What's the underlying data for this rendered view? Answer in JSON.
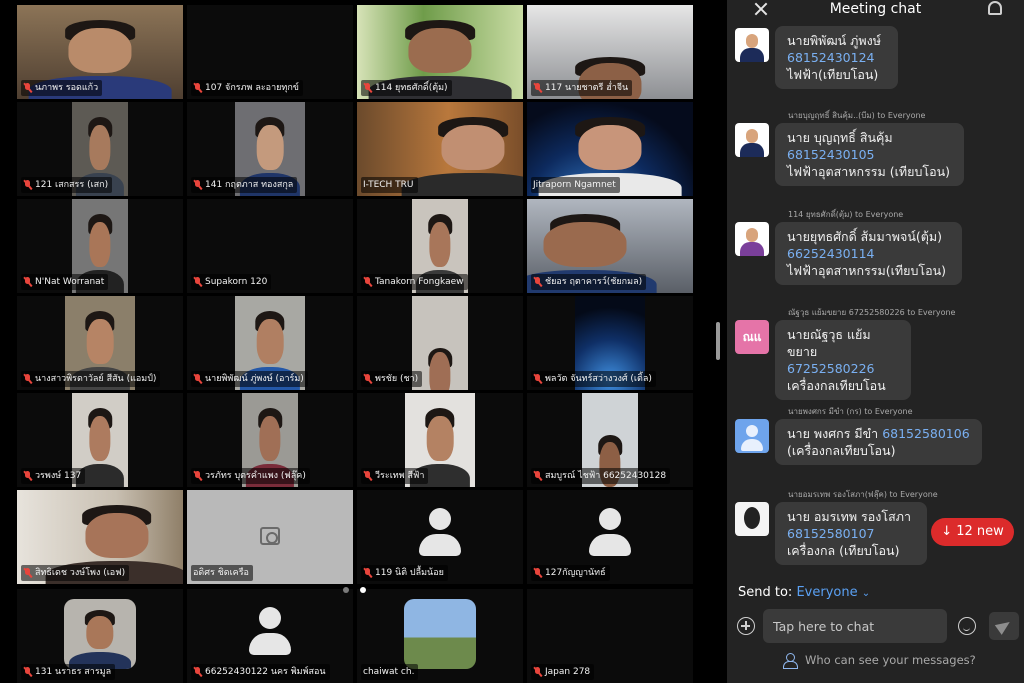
{
  "chat": {
    "title": "Meeting chat",
    "new_messages": "↓ 12 new",
    "send_to_label": "Send to:",
    "send_to_value": "Everyone",
    "input_placeholder": "Tap here to chat",
    "who_can_see": "Who can see your messages?",
    "messages": [
      {
        "header": "",
        "lines": [
          "นายพิพัฒน์ ภู่พงษ์",
          "68152430124",
          "ไฟฟ้า(เทียบโอน)"
        ]
      },
      {
        "header": "นายบุญฤทธิ์ สินคุ้ม..(บีม) to Everyone",
        "lines": [
          "นาย บุญฤทธิ์ สินคุ้ม",
          "68152430105",
          "ไฟฟ้าอุตสาหกรรม (เทียบโอน)"
        ]
      },
      {
        "header": "114 ยุทธศักดิ์(ตุ้ม) to Everyone",
        "lines": [
          "นายยุทธศักดิ์ ส้มมาพจน์(ตุ้ม)",
          "66252430114",
          "ไฟฟ้าอุตสาหกรรม(เทียบโอน)"
        ]
      },
      {
        "header": "ณัฐวุธ แย้มขยาย 67252580226 to Everyone",
        "lines": [
          "นายณัฐวุธ แย้มขยาย",
          "67252580226",
          "เครื่องกลเทียบโอน"
        ],
        "initials": "ณแ"
      },
      {
        "header": "นายพงศกร มีขำ (กร) to Everyone",
        "lines": [
          "นาย พงศกร มีขำ ",
          "68152580106",
          "(เครื่องกลเทียบโอน)"
        ]
      },
      {
        "header": "นายอมรเทพ รองโสภา(ฟลุ๊ค) to Everyone",
        "lines": [
          "นาย อมรเทพ รองโสภา",
          "68152580107",
          "เครื่องกล (เทียบโอน)"
        ]
      }
    ]
  },
  "participants": [
    {
      "name": "นภาพร รอดแก้ว"
    },
    {
      "name": "107 จักรภพ ละอายทุกข์"
    },
    {
      "name": "114 ยุทธศักดิ์(ตุ้ม)"
    },
    {
      "name": "117 นายชาตรี ฮ่ำจีน"
    },
    {
      "name": "121 เสกสรร (เสก)"
    },
    {
      "name": "141 กฤตภาส ทองสกุล"
    },
    {
      "name": "I-TECH TRU"
    },
    {
      "name": "Jitraporn Ngamnet"
    },
    {
      "name": "N'Nat Worranat"
    },
    {
      "name": "Supakorn 120"
    },
    {
      "name": "Tanakorn Fongkaew"
    },
    {
      "name": "ชัยอร ฤตาคารว์(ชัยกมล)"
    },
    {
      "name": "นางสาวพิรดาวัลย์ สีสัน (แอมป์)"
    },
    {
      "name": "นายพิพัฒน์ ภู่พงษ์ (อาร์ม)"
    },
    {
      "name": "พรชัย (ชา)"
    },
    {
      "name": "พลวัต จันทร์สว่างวงศ์ (เติ้ล)"
    },
    {
      "name": "วรพงษ์ 137"
    },
    {
      "name": "วรภัทร บุตรคำแพง (ฟลุ๊ค)"
    },
    {
      "name": "วีระเทพ สีฟ้า"
    },
    {
      "name": "สมบูรณ์ ไชฟ้า 66252430128"
    },
    {
      "name": "สิทธิเดช วงษ์โพง (เอฟ)"
    },
    {
      "name": "อดิศร ชิดเครือ"
    },
    {
      "name": "119 นิติ ปลื้มน้อย"
    },
    {
      "name": "127กัญญานัทธ์"
    },
    {
      "name": "131 นราธร สารมูล"
    },
    {
      "name": "66252430122 นคร พิมพ์สอน"
    },
    {
      "name": "chaiwat ch."
    },
    {
      "name": "Japan 278"
    }
  ],
  "colors": {
    "muted_mic": "#e8453c",
    "active_speaker": "#3dc35a",
    "link_blue": "#7ab0f2",
    "new_pill": "#dc2b2b"
  }
}
